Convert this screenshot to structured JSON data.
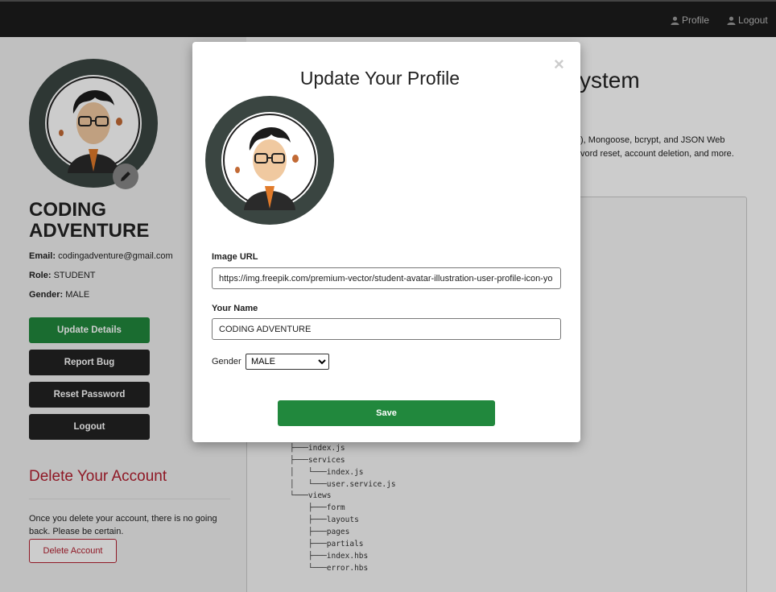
{
  "navbar": {
    "profile_label": "Profile",
    "logout_label": "Logout"
  },
  "profile": {
    "name_line1": "CODING",
    "name_line2": "ADVENTURE",
    "email_label": "Email:",
    "email": "codingadventure@gmail.com",
    "role_label": "Role:",
    "role": "STUDENT",
    "gender_label": "Gender:",
    "gender": "MALE"
  },
  "sidebar_buttons": {
    "update_details": "Update Details",
    "report_bug": "Report Bug",
    "reset_password": "Reset Password",
    "logout": "Logout"
  },
  "delete_section": {
    "title": "Delete Your Account",
    "text": "Once you delete your account, there is no going back. Please be certain.",
    "button": "Delete Account"
  },
  "main": {
    "heading_visible": "ystem",
    "desc_line1": "), Mongoose, bcrypt, and JSON Web",
    "desc_line2": "vord reset, account deletion, and more.",
    "tree_lines": [
      "├───index.js",
      "├───services",
      "│   └───index.js",
      "│   └───user.service.js",
      "└───views",
      "    ├───form",
      "    ├───layouts",
      "    ├───pages",
      "    ├───partials",
      "    ├───index.hbs",
      "    └───error.hbs"
    ]
  },
  "modal": {
    "close_symbol": "×",
    "title": "Update Your Profile",
    "image_url_label": "Image URL",
    "image_url_value": "https://img.freepik.com/premium-vector/student-avatar-illustration-user-profile-icon-yo",
    "name_label": "Your Name",
    "name_value": "CODING ADVENTURE",
    "gender_label": "Gender",
    "gender_value": "MALE",
    "save_label": "Save"
  },
  "colors": {
    "navbar": "#1c1c1c",
    "green": "#21883d",
    "dark_button": "#222222",
    "danger": "#b32030",
    "avatar_ring": "#3a4541"
  }
}
